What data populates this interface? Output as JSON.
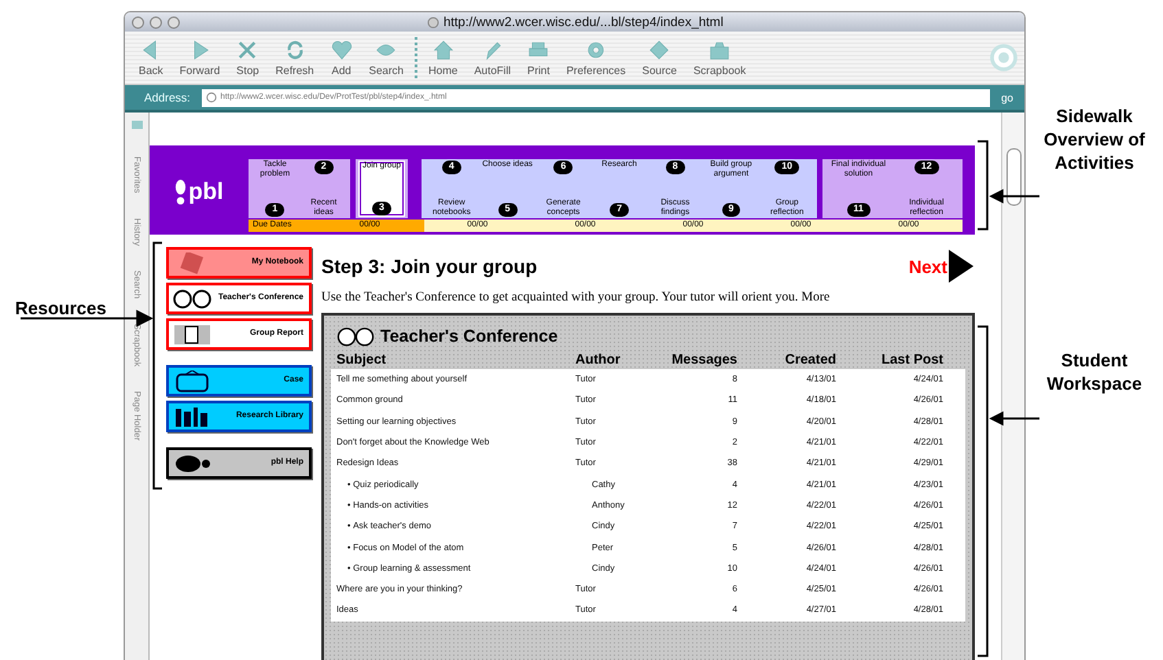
{
  "window": {
    "title": "http://www2.wcer.wisc.edu/...bl/step4/index_html"
  },
  "toolbar": [
    {
      "label": "Back"
    },
    {
      "label": "Forward"
    },
    {
      "label": "Stop"
    },
    {
      "label": "Refresh"
    },
    {
      "label": "Add"
    },
    {
      "label": "Search"
    },
    {
      "label": "Home"
    },
    {
      "label": "AutoFill"
    },
    {
      "label": "Print"
    },
    {
      "label": "Preferences"
    },
    {
      "label": "Source"
    },
    {
      "label": "Scrapbook"
    }
  ],
  "address_bar": {
    "label": "Address:",
    "value": "http://www2.wcer.wisc.edu/Dev/ProtTest/pbl/step4/index_.html",
    "button": "go"
  },
  "side_tabs": [
    "Favorites",
    "History",
    "Search",
    "Scrapbook",
    "Page Holder"
  ],
  "sidewalk": {
    "logo": "pbl",
    "groups": [
      {
        "color": "#cfa8f5",
        "steps": [
          {
            "label": "Tackle problem",
            "number": "1",
            "selected": false
          },
          {
            "label": "Recent ideas",
            "number": "2",
            "selected": false
          }
        ]
      },
      {
        "color": "#cfa8f5",
        "steps": [
          {
            "label": "Join group",
            "number": "3",
            "selected": true
          }
        ]
      },
      {
        "color": "#c8ccff",
        "steps": [
          {
            "label": "Review notebooks",
            "number": "4",
            "selected": false
          },
          {
            "label": "Choose ideas",
            "number": "5",
            "selected": false
          },
          {
            "label": "Generate concepts",
            "number": "6",
            "selected": false
          },
          {
            "label": "Research",
            "number": "7",
            "selected": false
          },
          {
            "label": "Discuss findings",
            "number": "8",
            "selected": false
          },
          {
            "label": "Build group argument",
            "number": "9",
            "selected": false
          },
          {
            "label": "Group reflection",
            "number": "10",
            "selected": false
          }
        ]
      },
      {
        "color": "#cfa8f5",
        "steps": [
          {
            "label": "Final individual solution",
            "number": "11",
            "selected": false
          },
          {
            "label": "Individual reflection",
            "number": "12",
            "selected": false
          }
        ]
      }
    ],
    "due_dates": [
      {
        "text": "Due Dates",
        "passed": true
      },
      {
        "text": "00/00",
        "passed": true
      },
      {
        "text": "00/00",
        "passed": false
      },
      {
        "text": "00/00",
        "passed": false
      },
      {
        "text": "00/00",
        "passed": false
      },
      {
        "text": "00/00",
        "passed": false
      },
      {
        "text": "00/00",
        "passed": false
      }
    ]
  },
  "resources": [
    {
      "label": "My Notebook",
      "color": "#ff8c8c",
      "kind": "personal"
    },
    {
      "label": "Teacher's Conference",
      "color": "#ffffff",
      "kind": "personal"
    },
    {
      "label": "Group Report",
      "color": "#ffffff",
      "kind": "personal"
    },
    {
      "label": "Case",
      "color": "#00ccff",
      "kind": "library"
    },
    {
      "label": "Research Library",
      "color": "#00ccff",
      "kind": "library"
    },
    {
      "label": "pbl Help",
      "color": "#c4c4c4",
      "kind": "help"
    }
  ],
  "step": {
    "title": "Step 3: Join your group",
    "next": "Next",
    "instructions": "Use the Teacher's Conference to get acquainted with your group.  Your tutor will orient you.  More"
  },
  "conference": {
    "title": "Teacher's Conference",
    "columns": [
      "Subject",
      "Author",
      "Messages",
      "Created",
      "Last Post"
    ],
    "rows": [
      {
        "subject": "Tell me something about yourself",
        "author": "Tutor",
        "messages": "8",
        "created": "4/13/01",
        "last_post": "4/24/01"
      },
      {
        "subject": "Common ground",
        "author": "Tutor",
        "messages": "11",
        "created": "4/18/01",
        "last_post": "4/26/01"
      },
      {
        "subject": "Setting our learning objectives",
        "author": "Tutor",
        "messages": "9",
        "created": "4/20/01",
        "last_post": "4/28/01"
      },
      {
        "subject": "Don't forget about the Knowledge Web",
        "author": "Tutor",
        "messages": "2",
        "created": "4/21/01",
        "last_post": "4/22/01"
      },
      {
        "subject": "Redesign Ideas",
        "author": "Tutor",
        "messages": "38",
        "created": "4/21/01",
        "last_post": "4/29/01",
        "children": [
          {
            "marker": "•",
            "subject": "Quiz periodically",
            "author": "Cathy",
            "messages": "4",
            "created": "4/21/01",
            "last_post": "4/23/01"
          },
          {
            "marker": "•",
            "subject": "Hands-on activities",
            "author": "Anthony",
            "messages": "12",
            "created": "4/22/01",
            "last_post": "4/26/01"
          },
          {
            "marker": "•",
            "subject": "Ask teacher's demo",
            "author": "Cindy",
            "messages": "7",
            "created": "4/22/01",
            "last_post": "4/25/01"
          },
          {
            "marker": "•",
            "subject": "Focus on Model of the atom",
            "author": "Peter",
            "messages": "5",
            "created": "4/26/01",
            "last_post": "4/28/01"
          },
          {
            "marker": "•",
            "subject": "Group learning & assessment",
            "author": "Cindy",
            "messages": "10",
            "created": "4/24/01",
            "last_post": "4/26/01"
          }
        ]
      },
      {
        "subject": "Where are you in your thinking?",
        "author": "Tutor",
        "messages": "6",
        "created": "4/25/01",
        "last_post": "4/26/01"
      },
      {
        "subject": "Ideas",
        "author": "Tutor",
        "messages": "4",
        "created": "4/27/01",
        "last_post": "4/28/01"
      }
    ]
  },
  "annotations": {
    "left": [
      "Resources"
    ],
    "right": [
      "Sidewalk Overview of Activities",
      "Student Workspace"
    ]
  }
}
